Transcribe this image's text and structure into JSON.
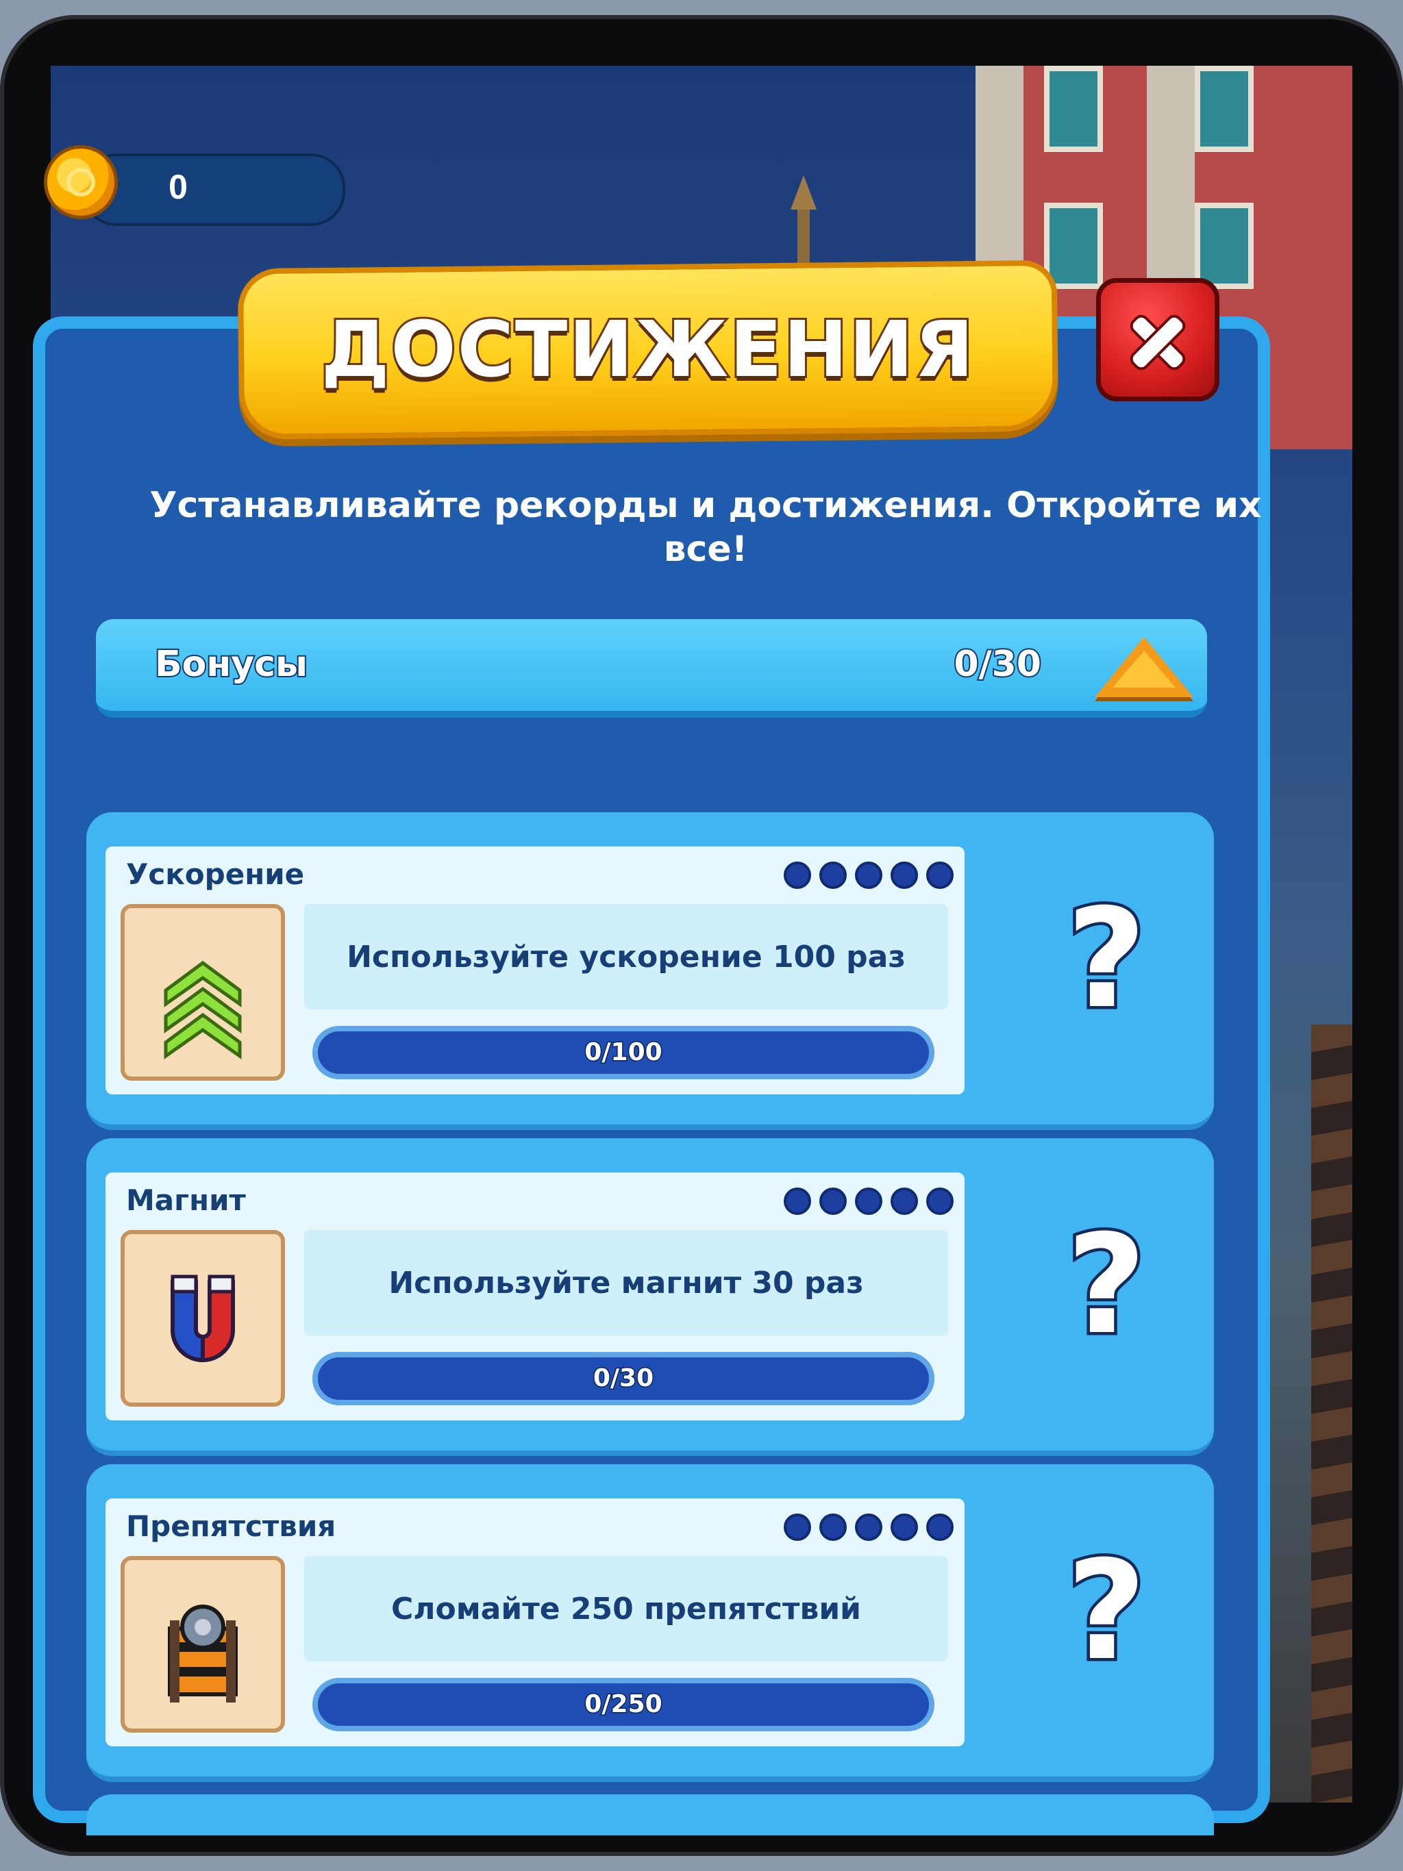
{
  "hud": {
    "coins": "0"
  },
  "dialog": {
    "title": "ДОСТИЖЕНИЯ",
    "subtitle_line1": "Устанавливайте рекорды и достижения. Откройте их",
    "subtitle_line2": "все!",
    "category": {
      "name": "Бонусы",
      "progress": "0/30",
      "expanded": true
    },
    "achievements": [
      {
        "name": "Ускорение",
        "icon": "boost-chevrons-icon",
        "description": "Используйте ускорение 100 раз",
        "progress_text": "0/100",
        "progress_fraction": 0,
        "stars_earned": 0,
        "stars_total": 5,
        "reward_hidden": "?"
      },
      {
        "name": "Магнит",
        "icon": "magnet-icon",
        "description": "Используйте магнит 30 раз",
        "progress_text": "0/30",
        "progress_fraction": 0,
        "stars_earned": 0,
        "stars_total": 5,
        "reward_hidden": "?"
      },
      {
        "name": "Препятствия",
        "icon": "barrier-icon",
        "description": "Сломайте 250 препятствий",
        "progress_text": "0/250",
        "progress_fraction": 0,
        "stars_earned": 0,
        "stars_total": 5,
        "reward_hidden": "?"
      }
    ]
  },
  "colors": {
    "panel": "#1f5cae",
    "panel_border": "#2fa8ee",
    "banner": "#ffcf1c",
    "close": "#d51e1e",
    "card": "#41b5f1",
    "progress": "#1f4db3"
  }
}
